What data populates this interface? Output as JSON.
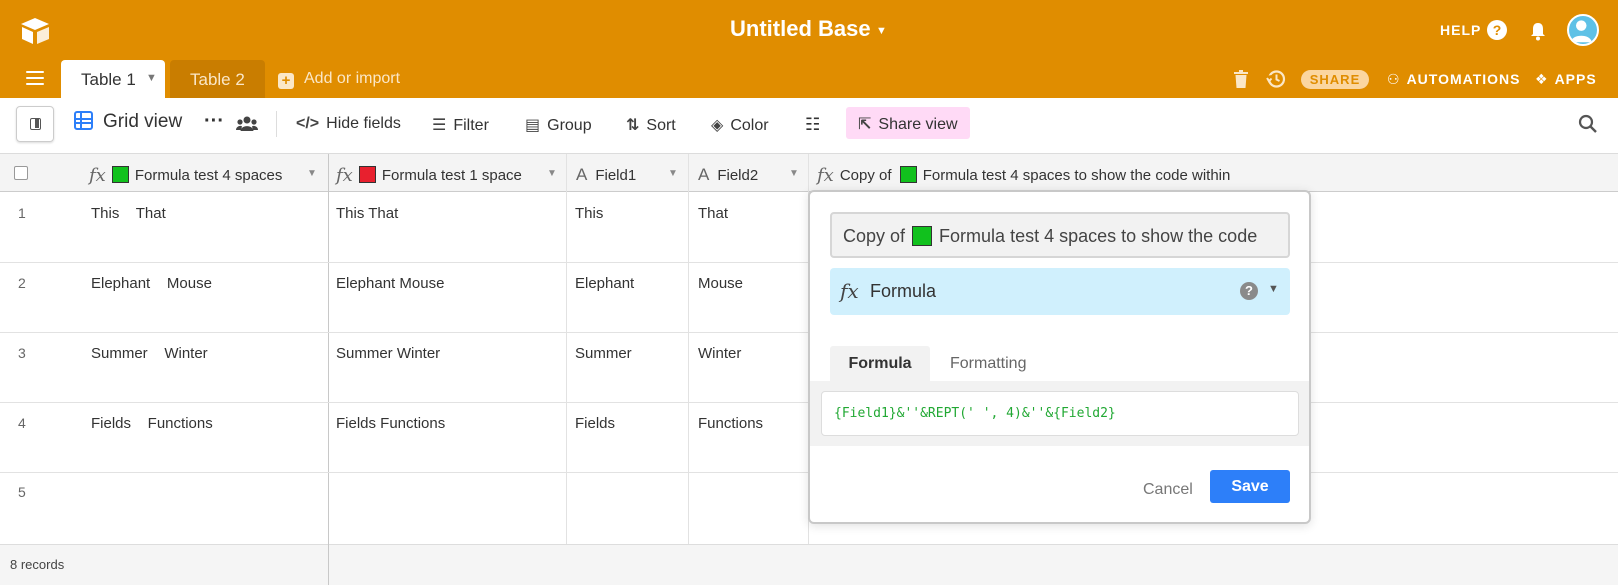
{
  "header": {
    "base_title": "Untitled Base",
    "help_label": "HELP",
    "share_label": "SHARE",
    "automations_label": "AUTOMATIONS",
    "apps_label": "APPS",
    "background_color": "#e08d00"
  },
  "tabs": [
    {
      "label": "Table 1",
      "active": true
    },
    {
      "label": "Table 2",
      "active": false
    }
  ],
  "add_import_label": "Add or import",
  "viewbar": {
    "view_name": "Grid view",
    "hide_fields": "Hide fields",
    "filter": "Filter",
    "group": "Group",
    "sort": "Sort",
    "color": "Color",
    "share_view": "Share view"
  },
  "columns": [
    {
      "name": "Formula test 4 spaces",
      "type": "formula",
      "swatch": "#11c11d"
    },
    {
      "name": "Formula test 1 space",
      "type": "formula",
      "swatch": "#e8202e"
    },
    {
      "name": "Field1",
      "type": "text"
    },
    {
      "name": "Field2",
      "type": "text"
    },
    {
      "name": "Copy of",
      "name_suffix": "Formula test 4 spaces to show the code within",
      "type": "formula",
      "swatch": "#11c11d"
    }
  ],
  "rows": [
    {
      "num": "1",
      "c1": "This    That",
      "c2": "This That",
      "c3": "This",
      "c4": "That"
    },
    {
      "num": "2",
      "c1": "Elephant    Mouse",
      "c2": "Elephant Mouse",
      "c3": "Elephant",
      "c4": "Mouse"
    },
    {
      "num": "3",
      "c1": "Summer    Winter",
      "c2": "Summer Winter",
      "c3": "Summer",
      "c4": "Winter"
    },
    {
      "num": "4",
      "c1": "Fields    Functions",
      "c2": "Fields Functions",
      "c3": "Fields",
      "c4": "Functions"
    },
    {
      "num": "5",
      "c1": "",
      "c2": "",
      "c3": "",
      "c4": ""
    }
  ],
  "footer": {
    "record_count": "8 records"
  },
  "field_editor": {
    "name_prefix": "Copy of",
    "name_suffix": "Formula test 4 spaces to show the code",
    "type_label": "Formula",
    "tab_formula": "Formula",
    "tab_formatting": "Formatting",
    "formula": "{Field1}&''&REPT(' ', 4)&''&{Field2}",
    "cancel_label": "Cancel",
    "save_label": "Save"
  },
  "icons": [
    "airtable-logo-icon",
    "help-icon",
    "bell-icon",
    "user-avatar-icon",
    "menu-icon",
    "trash-icon",
    "history-icon",
    "automations-icon",
    "apps-icon",
    "sidebar-toggle-icon",
    "grid-view-icon",
    "more-icon",
    "collaborators-icon",
    "hide-fields-icon",
    "filter-icon",
    "group-icon",
    "sort-icon",
    "color-icon",
    "row-height-icon",
    "share-view-icon",
    "search-icon"
  ]
}
